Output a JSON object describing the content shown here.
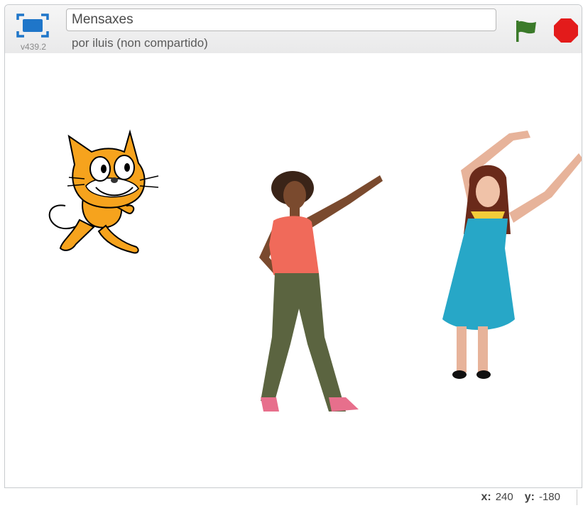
{
  "header": {
    "project_title": "Mensaxes",
    "version": "v439.2",
    "byline": "por iluis (non compartido)"
  },
  "controls": {
    "green_flag_icon": "green-flag-icon",
    "stop_icon": "stop-icon",
    "fullscreen_icon": "fullscreen-icon",
    "flag_color": "#3b7a2a",
    "stop_color": "#e31b1b"
  },
  "stage": {
    "sprites": [
      "cat-sprite",
      "dancer-red-top",
      "dancer-blue-dress"
    ]
  },
  "coords": {
    "x_label": "x:",
    "x_value": "240",
    "y_label": "y:",
    "y_value": "-180"
  }
}
